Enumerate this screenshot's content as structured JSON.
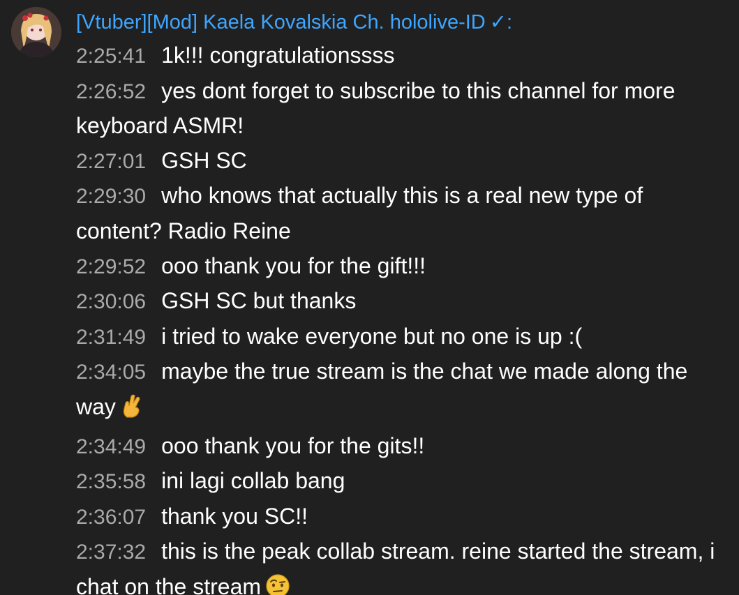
{
  "author": {
    "name": "[Vtuber][Mod] Kaela Kovalskia Ch. hololive-ID",
    "verified_mark": "✓",
    "separator": ":"
  },
  "messages": [
    {
      "time": "2:25:41",
      "text": "1k!!! congratulationssss"
    },
    {
      "time": "2:26:52",
      "text": "yes dont forget to subscribe to this channel for more keyboard ASMR!"
    },
    {
      "time": "2:27:01",
      "text": "GSH SC"
    },
    {
      "time": "2:29:30",
      "text": "who knows that actually this is a real new type of content? Radio Reine"
    },
    {
      "time": "2:29:52",
      "text": "ooo thank you for the gift!!!"
    },
    {
      "time": "2:30:06",
      "text": "GSH SC but thanks"
    },
    {
      "time": "2:31:49",
      "text": "i tried to wake everyone but no one is up :("
    },
    {
      "time": "2:34:05",
      "text": "maybe the true stream is the chat we made along the way",
      "emoji": "crossed-fingers-icon"
    },
    {
      "time": "2:34:49",
      "text": "ooo thank you for the gits!!"
    },
    {
      "time": "2:35:58",
      "text": "ini lagi collab bang"
    },
    {
      "time": "2:36:07",
      "text": "thank you SC!!"
    },
    {
      "time": "2:37:32",
      "text": "this is the peak collab stream. reine started the stream, i chat on the stream",
      "emoji": "face-with-raised-eyebrow-icon"
    }
  ],
  "colors": {
    "background": "#202020",
    "author": "#3ea6ff",
    "timestamp": "#aaaaaa",
    "text": "#ffffff"
  }
}
